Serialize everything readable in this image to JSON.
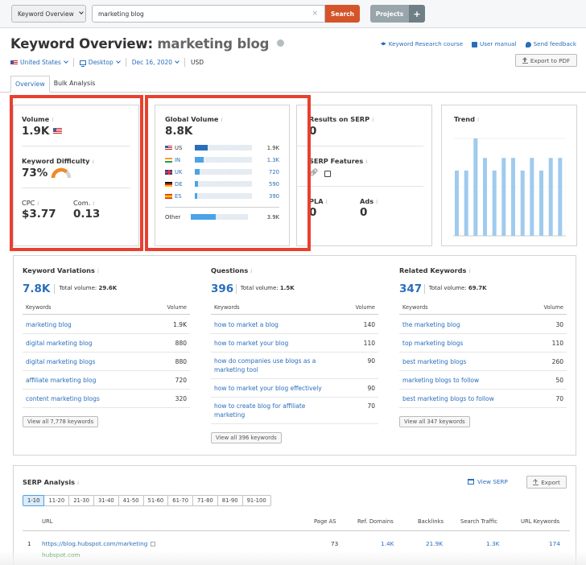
{
  "topbar": {
    "tool_select": "Keyword Overview",
    "search_value": "marketing blog",
    "search_clear": "×",
    "search_button": "Search",
    "projects_button": "Projects",
    "projects_add": "+"
  },
  "header": {
    "title_prefix": "Keyword Overview:",
    "title_keyword": "marketing blog",
    "filters": {
      "country": "United States",
      "device": "Desktop",
      "date": "Dec 16, 2020",
      "currency": "USD"
    },
    "links": [
      {
        "label": "Keyword Research course",
        "icon": "graduation-cap-icon"
      },
      {
        "label": "User manual",
        "icon": "book-icon"
      },
      {
        "label": "Send feedback",
        "icon": "chat-bubble-icon"
      }
    ],
    "export_pdf": "Export to PDF"
  },
  "tabs": [
    {
      "label": "Overview",
      "active": true
    },
    {
      "label": "Bulk Analysis",
      "active": false
    }
  ],
  "info_glyph": "i",
  "volume_card": {
    "volume_label": "Volume",
    "volume_value": "1.9K",
    "kd_label": "Keyword Difficulty",
    "kd_value": "73%",
    "kd_percent": 73,
    "kd_color": "#f08a24",
    "cpc_label": "CPC",
    "cpc_value": "$3.77",
    "com_label": "Com.",
    "com_value": "0.13"
  },
  "global_volume": {
    "label": "Global Volume",
    "value": "8.8K",
    "countries": [
      {
        "code": "US",
        "value": "1.9K",
        "share": 0.22,
        "flag": "us"
      },
      {
        "code": "IN",
        "value": "1.3K",
        "share": 0.15,
        "flag": "in"
      },
      {
        "code": "UK",
        "value": "720",
        "share": 0.08,
        "flag": "uk"
      },
      {
        "code": "DE",
        "value": "590",
        "share": 0.06,
        "flag": "de"
      },
      {
        "code": "ES",
        "value": "390",
        "share": 0.04,
        "flag": "es"
      }
    ],
    "other": {
      "label": "Other",
      "value": "3.9K",
      "share": 0.44
    }
  },
  "serp_card": {
    "results_label": "Results on SERP",
    "results_value": "0",
    "features_label": "SERP Features",
    "features": [
      "link-icon",
      "knowledge-panel-icon"
    ],
    "pla_label": "PLA",
    "pla_value": "0",
    "ads_label": "Ads",
    "ads_value": "0"
  },
  "trend": {
    "label": "Trend",
    "bar_color": "#9fcbee",
    "values": [
      0.67,
      0.67,
      1.0,
      0.8,
      0.67,
      0.8,
      0.8,
      0.67,
      0.8,
      0.67,
      0.8,
      0.8
    ]
  },
  "keyword_sections": [
    {
      "title": "Keyword Variations",
      "count": "7.8K",
      "total_label": "Total volume:",
      "total_value": "29.6K",
      "col_keywords": "Keywords",
      "col_volume": "Volume",
      "rows": [
        {
          "keyword": "marketing blog",
          "volume": "1.9K"
        },
        {
          "keyword": "digital marketing blog",
          "volume": "880"
        },
        {
          "keyword": "digital marketing blogs",
          "volume": "880"
        },
        {
          "keyword": "affiliate marketing blog",
          "volume": "720"
        },
        {
          "keyword": "content marketing blogs",
          "volume": "320"
        }
      ],
      "view_all": "View all 7,778 keywords"
    },
    {
      "title": "Questions",
      "count": "396",
      "total_label": "Total volume:",
      "total_value": "1.5K",
      "col_keywords": "Keywords",
      "col_volume": "Volume",
      "rows": [
        {
          "keyword": "how to market a blog",
          "volume": "140"
        },
        {
          "keyword": "how to market your blog",
          "volume": "110"
        },
        {
          "keyword": "how do companies use blogs as a marketing tool",
          "volume": "90"
        },
        {
          "keyword": "how to market your blog effectively",
          "volume": "90"
        },
        {
          "keyword": "how to create blog for affiliate marketing",
          "volume": "70"
        }
      ],
      "view_all": "View all 396 keywords"
    },
    {
      "title": "Related Keywords",
      "count": "347",
      "total_label": "Total volume:",
      "total_value": "69.7K",
      "col_keywords": "Keywords",
      "col_volume": "Volume",
      "rows": [
        {
          "keyword": "the marketing blog",
          "volume": "30"
        },
        {
          "keyword": "top marketing blogs",
          "volume": "110"
        },
        {
          "keyword": "best marketing blogs",
          "volume": "260"
        },
        {
          "keyword": "marketing blogs to follow",
          "volume": "50"
        },
        {
          "keyword": "best marketing blogs to follow",
          "volume": "70"
        }
      ],
      "view_all": "View all 347 keywords"
    }
  ],
  "serp_analysis": {
    "title": "SERP Analysis",
    "view_serp": "View SERP",
    "export": "Export",
    "pages": [
      "1-10",
      "11-20",
      "21-30",
      "31-40",
      "41-50",
      "51-60",
      "61-70",
      "71-80",
      "81-90",
      "91-100"
    ],
    "active_page": "1-10",
    "columns": [
      "URL",
      "Page AS",
      "Ref. Domains",
      "Backlinks",
      "Search Traffic",
      "URL Keywords"
    ],
    "rows": [
      {
        "position": "1",
        "url": "https://blog.hubspot.com/marketing",
        "domain": "hubspot.com",
        "page_as": "73",
        "ref_domains": "1.4K",
        "backlinks": "21.9K",
        "search_traffic": "1.3K",
        "url_keywords": "174"
      }
    ]
  },
  "annotation_color": "#e8402f"
}
